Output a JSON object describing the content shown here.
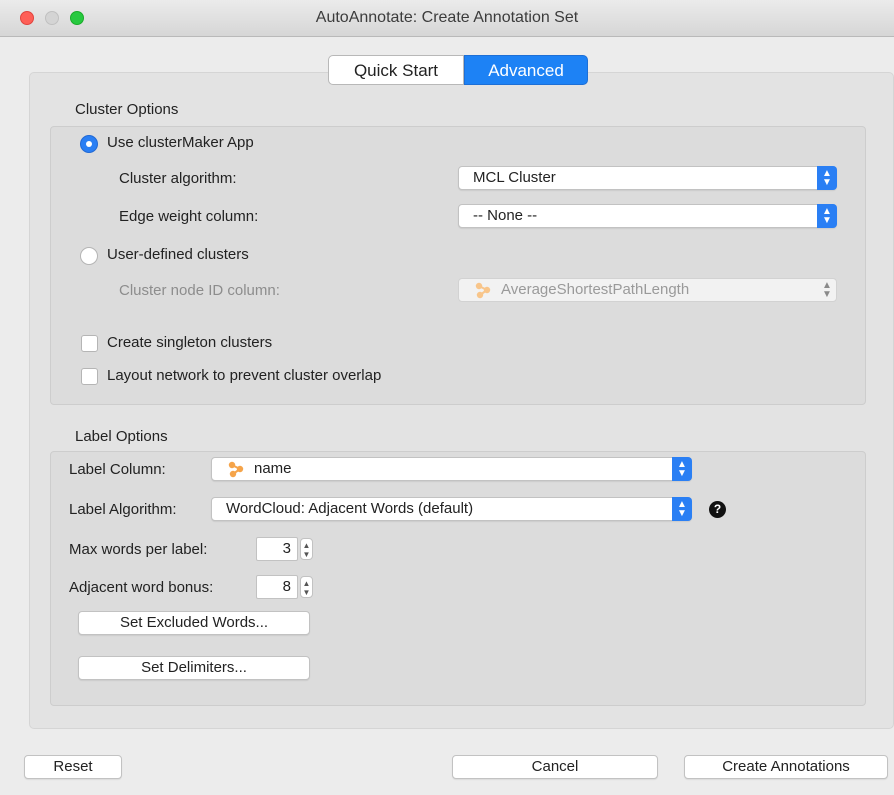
{
  "window": {
    "title": "AutoAnnotate: Create Annotation Set"
  },
  "tabs": [
    {
      "label": "Quick Start",
      "selected": false
    },
    {
      "label": "Advanced",
      "selected": true
    }
  ],
  "cluster_options": {
    "title": "Cluster Options",
    "use_clustermaker": {
      "label": "Use clusterMaker App",
      "selected": true
    },
    "cluster_algorithm": {
      "label": "Cluster algorithm:",
      "value": "MCL Cluster"
    },
    "edge_weight_column": {
      "label": "Edge weight column:",
      "value": "-- None --"
    },
    "user_defined": {
      "label": "User-defined clusters",
      "selected": false
    },
    "cluster_node_id": {
      "label": "Cluster node ID column:",
      "value": "AverageShortestPathLength",
      "enabled": false
    },
    "singleton": {
      "label": "Create singleton clusters",
      "checked": false
    },
    "layout": {
      "label": "Layout network to prevent cluster overlap",
      "checked": false
    }
  },
  "label_options": {
    "title": "Label Options",
    "label_column": {
      "label": "Label Column:",
      "value": "name"
    },
    "label_algorithm": {
      "label": "Label Algorithm:",
      "value": "WordCloud: Adjacent Words (default)"
    },
    "max_words": {
      "label": "Max words per label:",
      "value": "3"
    },
    "adjacent_bonus": {
      "label": "Adjacent word bonus:",
      "value": "8"
    },
    "excluded_words_button": "Set Excluded Words...",
    "delimiters_button": "Set Delimiters..."
  },
  "footer": {
    "reset": "Reset",
    "cancel": "Cancel",
    "create": "Create Annotations"
  },
  "colors": {
    "accent": "#2a7ff4",
    "close": "#fe5f57",
    "maximize": "#27c93f",
    "node_icon": "#f5a44a"
  },
  "icons": {
    "node_column": "node-network-icon",
    "help": "question-circle-icon"
  }
}
